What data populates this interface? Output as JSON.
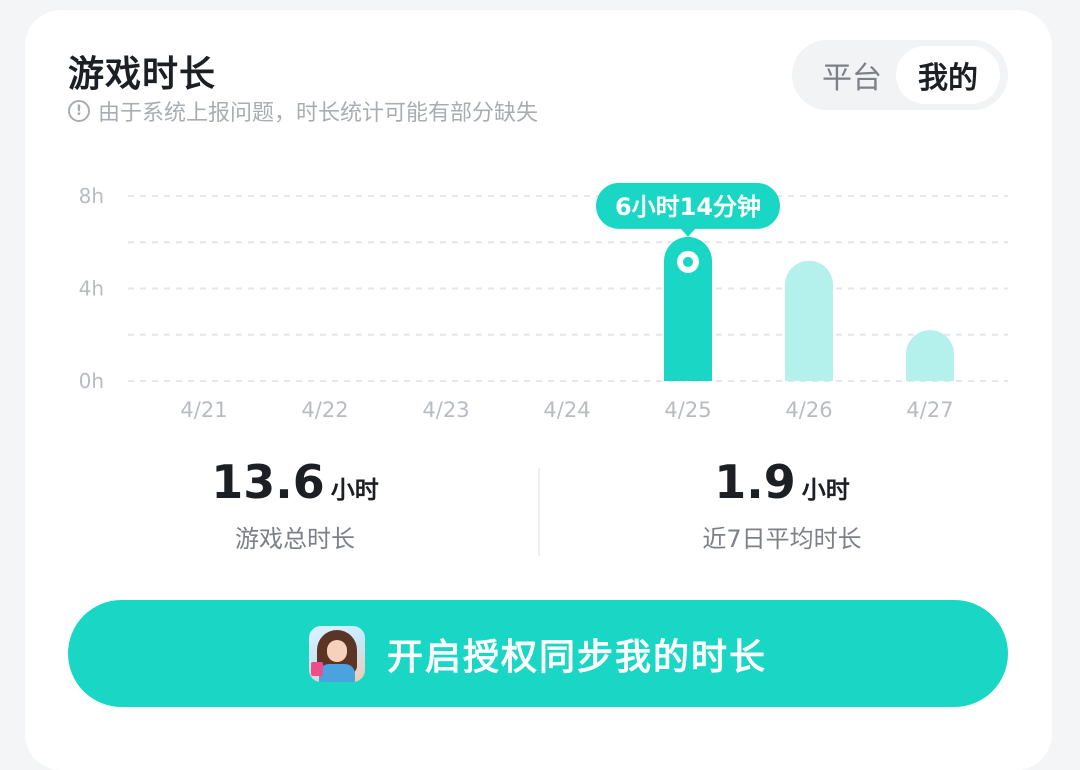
{
  "header": {
    "title": "游戏时长",
    "notice": "由于系统上报问题，时长统计可能有部分缺失",
    "info_icon": "info-icon"
  },
  "segmented": {
    "options": [
      "平台",
      "我的"
    ],
    "selected": "我的"
  },
  "chart_data": {
    "type": "bar",
    "categories": [
      "4/21",
      "4/22",
      "4/23",
      "4/24",
      "4/25",
      "4/26",
      "4/27"
    ],
    "values": [
      0,
      0,
      0,
      0,
      6.23,
      5.2,
      2.2
    ],
    "y_ticks": [
      "0h",
      "4h",
      "8h"
    ],
    "ylim": [
      0,
      8
    ],
    "grid": true,
    "highlight_index": 4,
    "tooltip": "6小时14分钟",
    "colors": {
      "highlight": "#19d6c5",
      "normal": "#b5f1ec",
      "grid": "#e3e6ea",
      "tick": "#b8bcc2"
    }
  },
  "stats": {
    "total": {
      "value": "13.6",
      "unit": "小时",
      "label": "游戏总时长"
    },
    "average": {
      "value": "1.9",
      "unit": "小时",
      "label": "近7日平均时长"
    }
  },
  "sync_button": {
    "label": "开启授权同步我的时长",
    "icon": "game-avatar-icon",
    "color": "#19d6c5"
  }
}
